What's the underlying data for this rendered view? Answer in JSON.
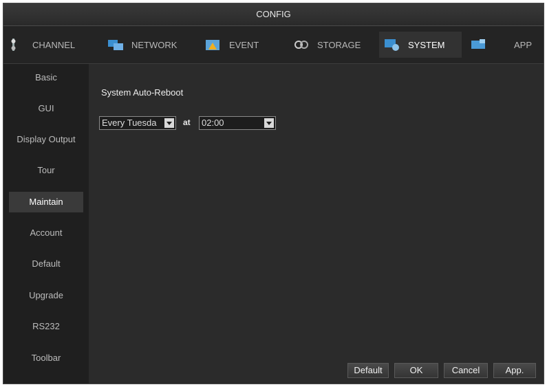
{
  "window": {
    "title": "CONFIG"
  },
  "tabs": [
    {
      "label": "CHANNEL",
      "icon": "channel-icon"
    },
    {
      "label": "NETWORK",
      "icon": "network-icon"
    },
    {
      "label": "EVENT",
      "icon": "event-icon"
    },
    {
      "label": "STORAGE",
      "icon": "storage-icon"
    },
    {
      "label": "SYSTEM",
      "icon": "system-icon",
      "active": true
    },
    {
      "label": "APP",
      "icon": "app-icon"
    }
  ],
  "sidebar": {
    "items": [
      {
        "label": "Basic"
      },
      {
        "label": "GUI"
      },
      {
        "label": "Display Output"
      },
      {
        "label": "Tour"
      },
      {
        "label": "Maintain",
        "active": true
      },
      {
        "label": "Account"
      },
      {
        "label": "Default"
      },
      {
        "label": "Upgrade"
      },
      {
        "label": "RS232"
      },
      {
        "label": "Toolbar"
      }
    ]
  },
  "main": {
    "section_title": "System Auto-Reboot",
    "reboot_day": "Every Tuesda",
    "at_label": "at",
    "reboot_time": "02:00"
  },
  "footer": {
    "default_label": "Default",
    "ok_label": "OK",
    "cancel_label": "Cancel",
    "apply_label": "App."
  },
  "colors": {
    "background": "#1b1b1b",
    "content": "#2b2b2b",
    "active_item": "#3a3a3a"
  }
}
